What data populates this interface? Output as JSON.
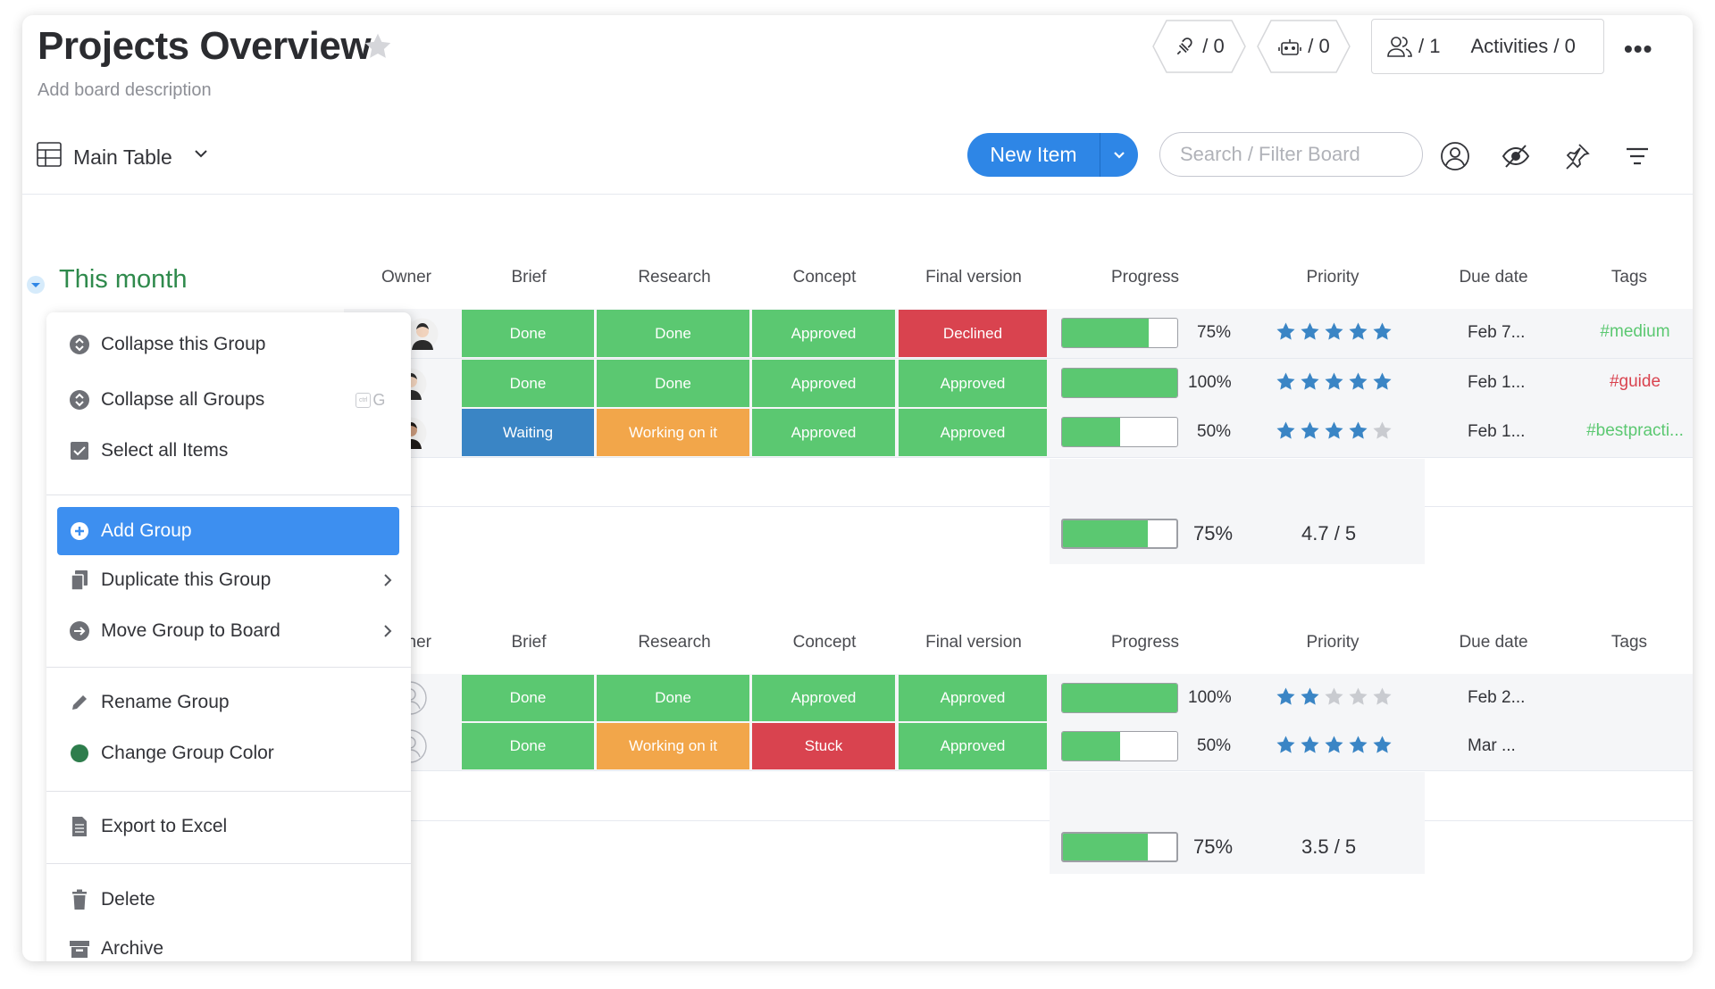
{
  "header": {
    "title": "Projects Overview",
    "description_placeholder": "Add board description",
    "integrations_count": "/ 0",
    "automations_count": "/ 0",
    "members_count": "/ 1",
    "activities_label": "Activities / 0",
    "more_label": "•••"
  },
  "toolbar": {
    "view_label": "Main Table",
    "new_item_label": "New Item",
    "search_placeholder": "Search / Filter Board"
  },
  "group1": {
    "title": "This month",
    "columns": [
      "Owner",
      "Brief",
      "Research",
      "Concept",
      "Final version",
      "Progress",
      "Priority",
      "Due date",
      "Tags"
    ],
    "rows": [
      {
        "brief": "Done",
        "research": "Done",
        "concept": "Approved",
        "final": "Declined",
        "progress": 0.75,
        "progress_label": "75%",
        "stars": 5,
        "due": "Feb 7...",
        "tag": "#medium",
        "tag_color": "#5bc871"
      },
      {
        "brief": "Done",
        "research": "Done",
        "concept": "Approved",
        "final": "Approved",
        "progress": 1.0,
        "progress_label": "100%",
        "stars": 5,
        "due": "Feb 1...",
        "tag": "#guide",
        "tag_color": "#d9434f"
      },
      {
        "brief": "Waiting",
        "research": "Working on it",
        "concept": "Approved",
        "final": "Approved",
        "progress": 0.5,
        "progress_label": "50%",
        "stars": 4,
        "due": "Feb 1...",
        "tag": "#bestpracti...",
        "tag_color": "#5bc871"
      }
    ],
    "summary_progress": 0.75,
    "summary_progress_label": "75%",
    "summary_rating": "4.7 / 5"
  },
  "group2": {
    "columns": [
      "Owner",
      "Brief",
      "Research",
      "Concept",
      "Final version",
      "Progress",
      "Priority",
      "Due date",
      "Tags"
    ],
    "rows": [
      {
        "brief": "Done",
        "research": "Done",
        "concept": "Approved",
        "final": "Approved",
        "progress": 1.0,
        "progress_label": "100%",
        "stars": 2,
        "due": "Feb 2...",
        "tag": ""
      },
      {
        "brief": "Done",
        "research": "Working on it",
        "concept": "Stuck",
        "final": "Approved",
        "progress": 0.5,
        "progress_label": "50%",
        "stars": 5,
        "due": "Mar ...",
        "tag": ""
      }
    ],
    "summary_progress": 0.75,
    "summary_progress_label": "75%",
    "summary_rating": "3.5 / 5"
  },
  "status_colors": {
    "Done": "#5bc871",
    "Approved": "#5bc871",
    "Declined": "#d9434f",
    "Stuck": "#d9434f",
    "Waiting": "#3a85c5",
    "Working on it": "#f2a64a"
  },
  "menu": {
    "collapse_group": "Collapse this Group",
    "collapse_all": "Collapse all Groups",
    "shortcut_key": "G",
    "shortcut_mod": "ctrl",
    "select_all": "Select all Items",
    "add_group": "Add Group",
    "duplicate": "Duplicate this Group",
    "move": "Move Group to Board",
    "rename": "Rename Group",
    "change_color": "Change Group Color",
    "export": "Export to Excel",
    "delete": "Delete",
    "archive": "Archive"
  },
  "colors": {
    "accent": "#2e86e6",
    "menu_active": "#3d8ff0",
    "group_green": "#2f8a4c",
    "star_blue": "#3a85c5",
    "star_grey": "#c9cbd0"
  }
}
